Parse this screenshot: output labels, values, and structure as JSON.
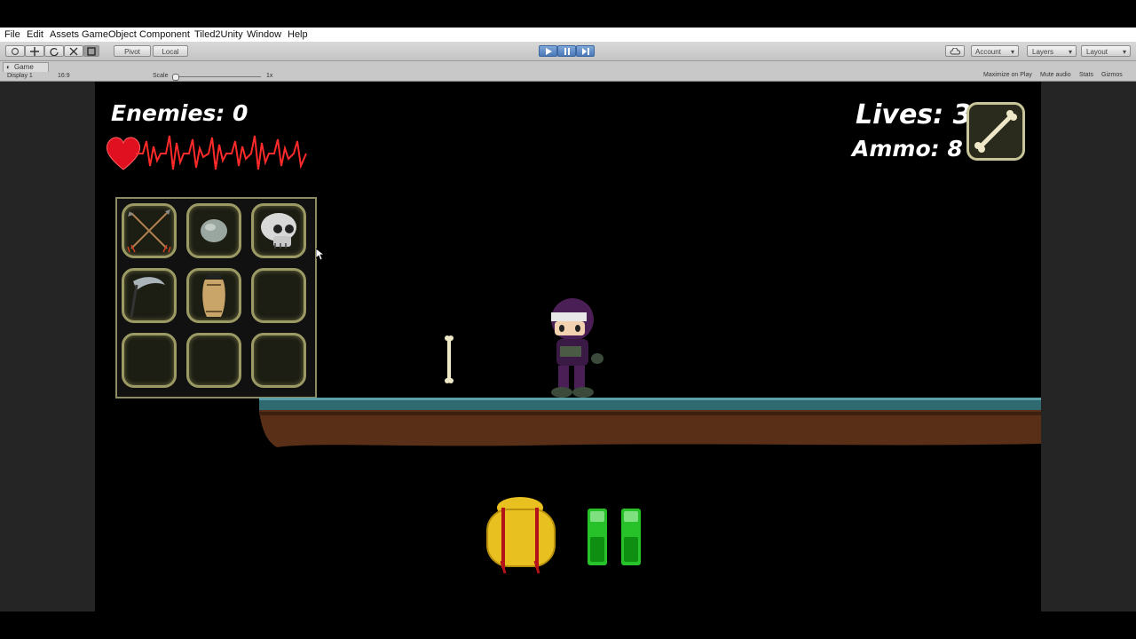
{
  "menu": [
    "File",
    "Edit",
    "Assets",
    "GameObject",
    "Component",
    "Tiled2Unity",
    "Window",
    "Help"
  ],
  "toolbar": {
    "pivot_label": "Pivot",
    "local_label": "Local",
    "account_label": "Account",
    "layers_label": "Layers",
    "layout_label": "Layout"
  },
  "game_tab": {
    "title": "Game",
    "display": "Display 1",
    "aspect": "16:9",
    "scale_label": "Scale",
    "scale_value": "1x",
    "maximize_on_play": "Maximize on Play",
    "mute_audio": "Mute audio",
    "stats": "Stats",
    "gizmos": "Gizmos"
  },
  "hud": {
    "enemies": "Enemies: 0",
    "lives": "Lives: 3",
    "ammo": "Ammo: 8",
    "equipped_icon": "bone-icon"
  },
  "inventory": {
    "slots": [
      "crossed-arrows-icon",
      "stone-icon",
      "skull-icon",
      "scythe-icon",
      "urn-icon",
      "",
      "",
      "",
      ""
    ]
  },
  "colors": {
    "heart": "#e01020",
    "slot_border": "#9c9a64",
    "ground_top": "#2f6a70",
    "ground_dirt": "#5a2f18",
    "pause_green": "#27c22a",
    "backpack": "#e8c020",
    "play_active": "#5b86c4"
  }
}
